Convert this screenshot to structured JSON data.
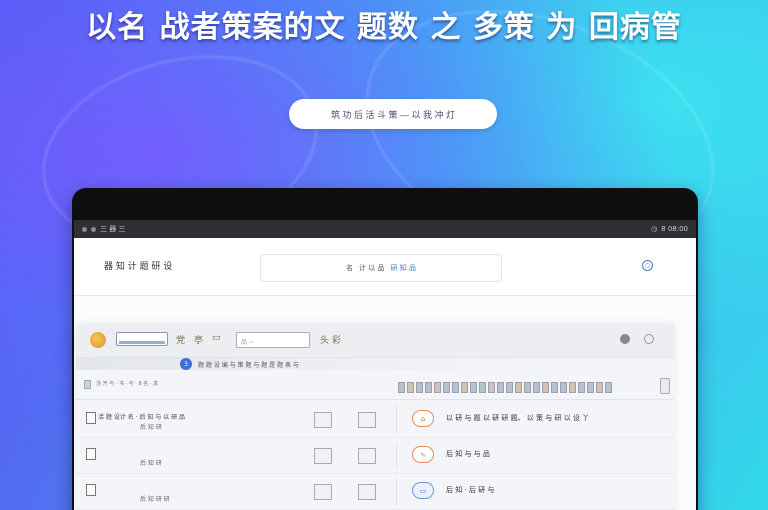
{
  "hero": {
    "title": "以名 战者策案的文 题数 之 多策 为 回病管",
    "cta_label": "筑 功 后 活 斗 策 — 以 我 冲 灯"
  },
  "device": {
    "statusbar": {
      "left_text": "三 器 三",
      "right_icon": "clock-icon",
      "right_text": "8 08:00"
    }
  },
  "app": {
    "name": "器 知 计 题 研 设",
    "search": {
      "prefix": "名",
      "placeholder": "计 以 品",
      "accent": "研 知 品"
    },
    "header_icon": "○"
  },
  "toolbar": {
    "input_placeholder": "品 ~",
    "icon1": "党",
    "icon2": "亭",
    "icon3": "头 彩"
  },
  "filter": {
    "badge": "3",
    "text": "题 题 设 编 与 策 题 与 题 是 题 表 与"
  },
  "list_header": {
    "text": "活 开 与 · 书 · 与 · 8 名 · 发"
  },
  "rows": [
    {
      "title": "活 题 设计 名 · 后 知 与 以 研 品",
      "sub": "后 知 研",
      "pill": "⌂",
      "pill_style": "orange",
      "desc": "以 研 与 题 以 研 研 题、 以 策 与 研 以 设 丫"
    },
    {
      "title": "",
      "sub": "后 知 研",
      "pill": "∿",
      "pill_style": "orange",
      "desc": "后 知 与 与 品"
    },
    {
      "title": "",
      "sub": "后 知 研 研",
      "pill": "▭",
      "pill_style": "blue",
      "desc": "后 知 · 后 研 与"
    }
  ],
  "colors": {
    "accent": "#3c6fd8",
    "brand_orange": "#e58a5a"
  }
}
